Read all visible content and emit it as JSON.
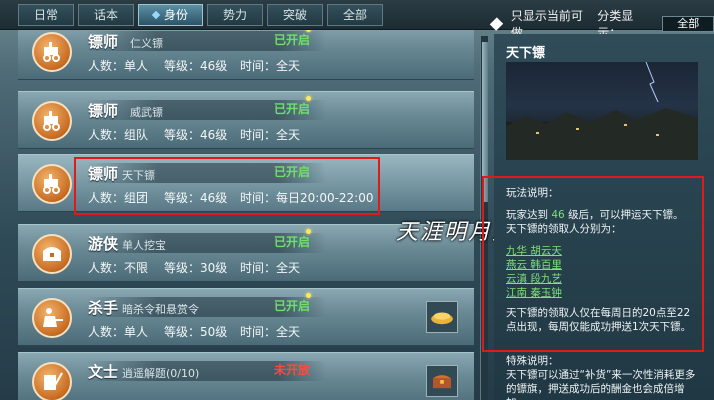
{
  "tabs": [
    "日常",
    "话本",
    "身份",
    "势力",
    "突破",
    "全部"
  ],
  "active_tab_index": 2,
  "filter": {
    "only_available_label": "只显示当前可做",
    "category_label": "分类显示：",
    "category_value": "全部"
  },
  "cards": [
    {
      "title": "镖师",
      "sub": "仁义镖",
      "status": "已开启",
      "status_color": "#6ee06a",
      "count_label": "人数：单人",
      "level_label": "等级：46级",
      "time_label": "时间：全天",
      "has_dot": true
    },
    {
      "title": "镖师",
      "sub": "威武镖",
      "status": "已开启",
      "status_color": "#6ee06a",
      "count_label": "人数：组队",
      "level_label": "等级：46级",
      "time_label": "时间：全天",
      "has_dot": true
    },
    {
      "title": "镖师",
      "sub": "天下镖",
      "status": "已开启",
      "status_color": "#6ee06a",
      "count_label": "人数：组团",
      "level_label": "等级：46级",
      "time_label": "时间：每日20:00-22:00",
      "has_dot": false
    },
    {
      "title": "游侠",
      "sub": "单人挖宝",
      "status": "已开启",
      "status_color": "#6ee06a",
      "count_label": "人数：不限",
      "level_label": "等级：30级",
      "time_label": "时间：全天",
      "has_dot": true
    },
    {
      "title": "杀手",
      "sub": "暗杀令和悬赏令",
      "status": "已开启",
      "status_color": "#6ee06a",
      "count_label": "人数：单人",
      "level_label": "等级：50级",
      "time_label": "时间：全天",
      "has_dot": true
    },
    {
      "title": "文士",
      "sub": "逍遥解题(0/10)",
      "status": "未开放",
      "status_color": "#ff4a3a",
      "count_label": "",
      "level_label": "",
      "time_label": "",
      "has_dot": false
    }
  ],
  "watermark": "天涯明月刀",
  "panel": {
    "title": "天下镖",
    "rules_heading": "玩法说明：",
    "rules_line1_a": "玩家达到",
    "rules_line1_level": "46",
    "rules_line1_b": "级后，可以押运天下镖。",
    "rules_line2": "天下镖的领取人分别为：",
    "npcs": [
      "九华 胡云天",
      "燕云 韩百里",
      "云滇 段九艺",
      "江南 秦玉钟"
    ],
    "rules_line3": "天下镖的领取人仅在每周日的20点至22点出现，每周仅能成功押送1次天下镖。",
    "special_heading": "特殊说明：",
    "special_text": "天下镖可以通过“补货”来一次性消耗更多的镖旗，押送成功后的酬金也会成倍增加。"
  }
}
